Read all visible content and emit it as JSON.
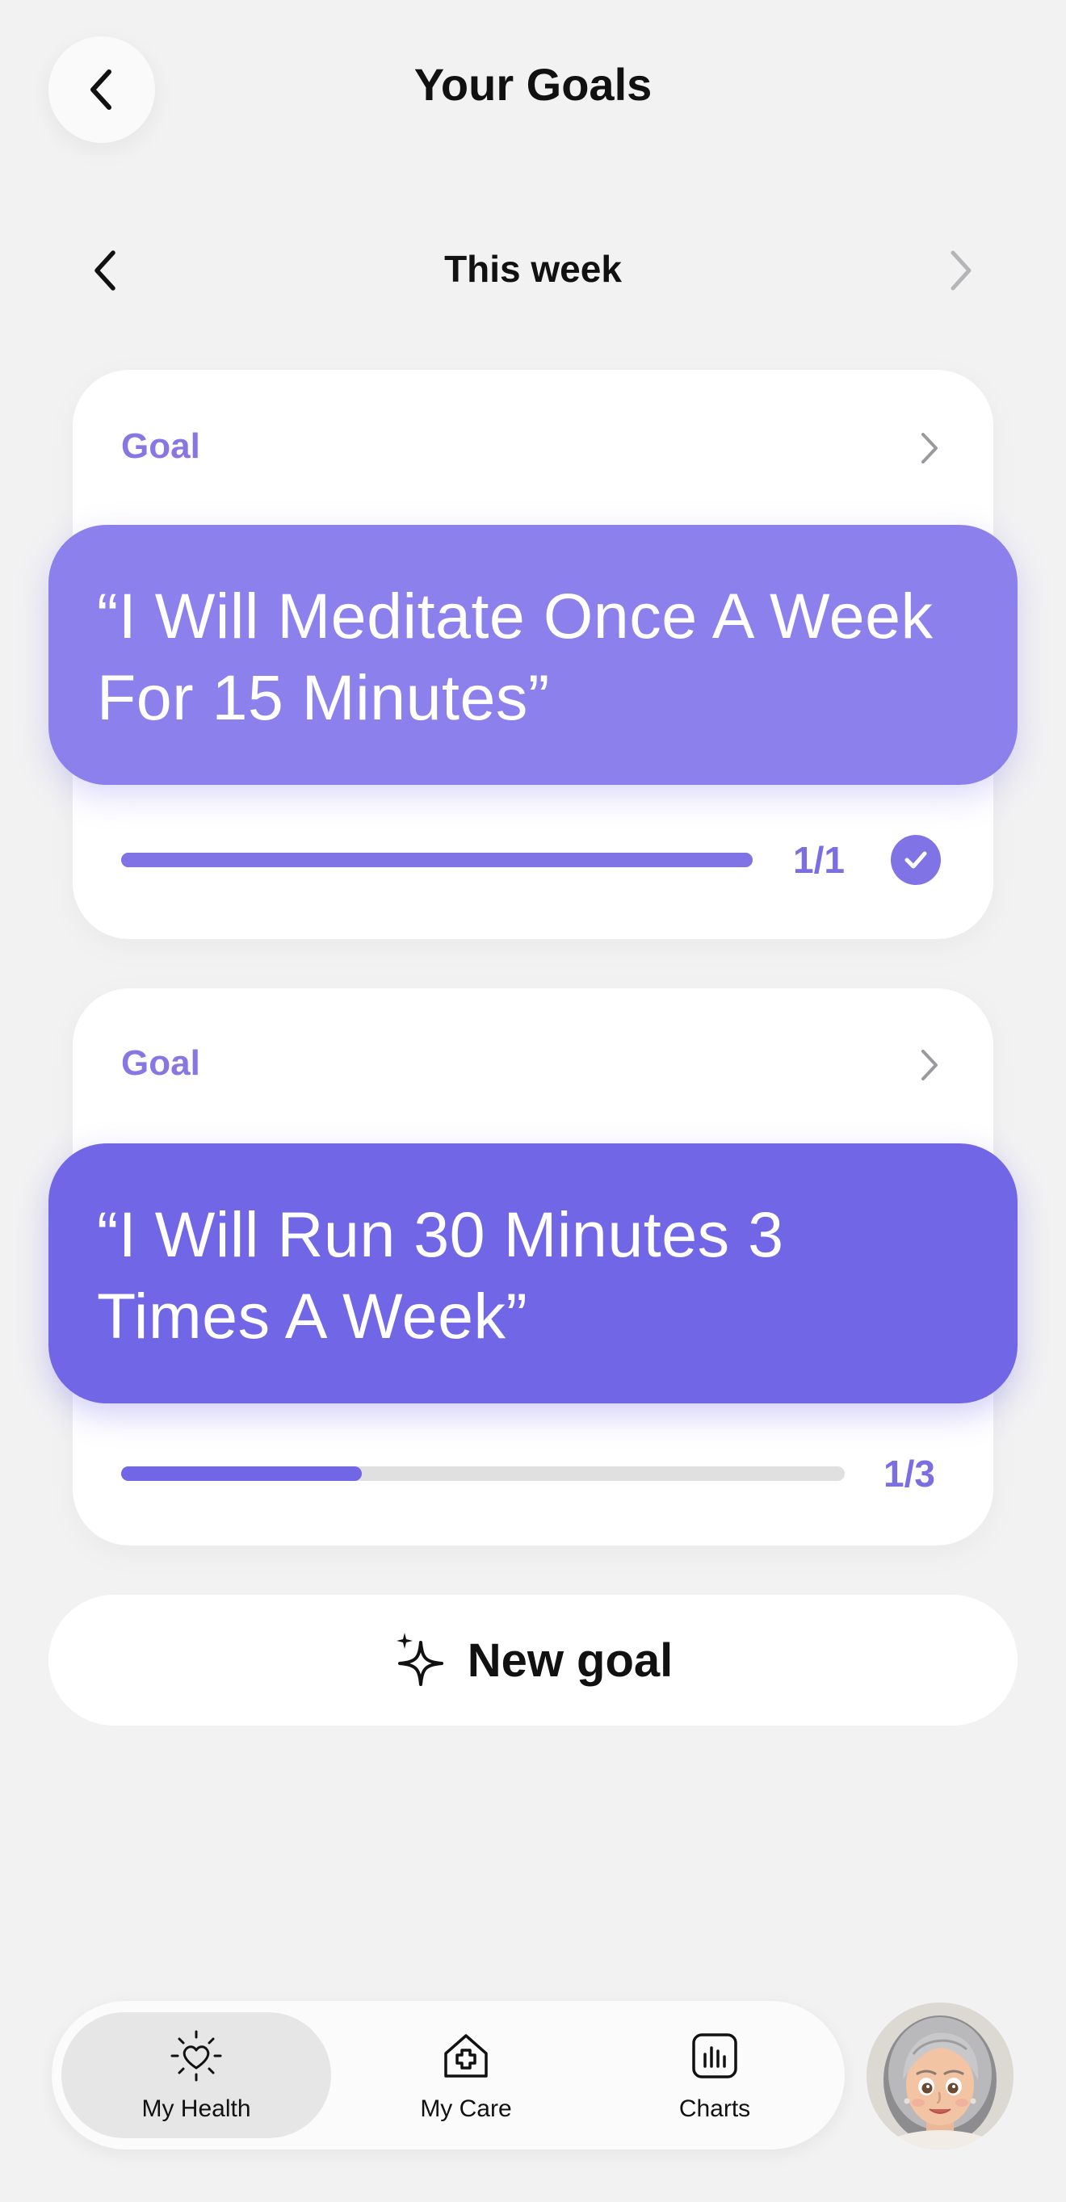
{
  "header": {
    "title": "Your Goals"
  },
  "week_selector": {
    "label": "This week"
  },
  "goals": [
    {
      "tag": "Goal",
      "text": "“I Will Meditate Once A Week For 15 Minutes”",
      "progress_count": "1/1",
      "progress_fraction": 1.0,
      "completed": true
    },
    {
      "tag": "Goal",
      "text": "“I Will Run 30 Minutes 3 Times A Week”",
      "progress_count": "1/3",
      "progress_fraction": 0.333,
      "completed": false
    }
  ],
  "new_goal": {
    "label": "New goal"
  },
  "nav": {
    "items": [
      {
        "label": "My Health",
        "icon": "heart-sun-icon",
        "active": true
      },
      {
        "label": "My Care",
        "icon": "house-plus-icon",
        "active": false
      },
      {
        "label": "Charts",
        "icon": "bar-chart-icon",
        "active": false
      }
    ]
  },
  "colors": {
    "accent": "#7a6ee2",
    "goal1_bg": "#8c80ec",
    "goal2_bg": "#7166e6",
    "track": "#e0e0e0"
  }
}
